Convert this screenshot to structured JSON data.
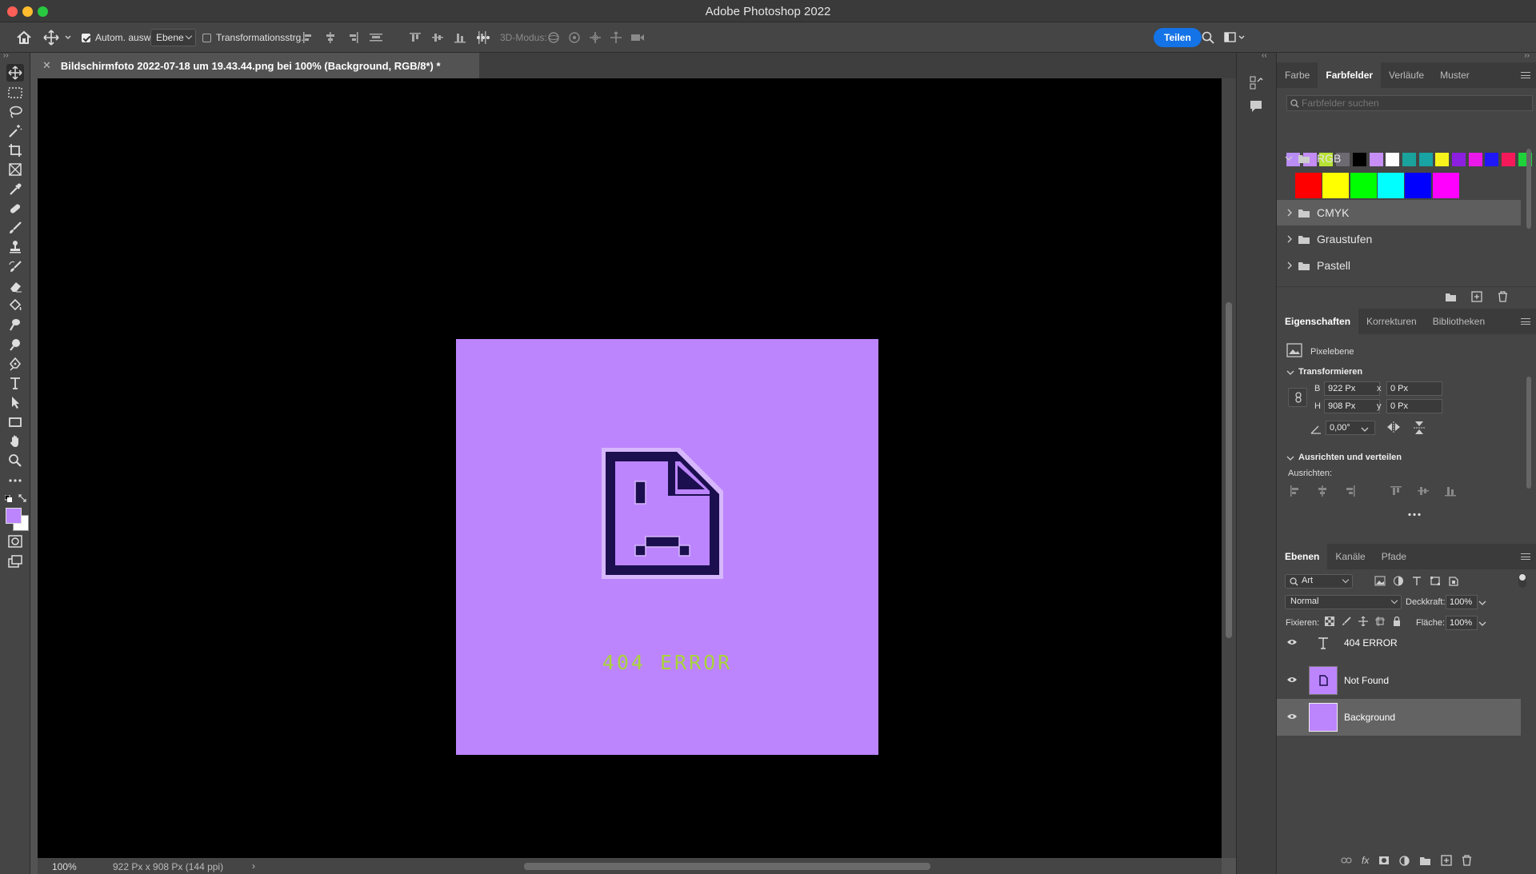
{
  "window": {
    "title": "Adobe Photoshop 2022"
  },
  "options_bar": {
    "auto_select_label": "Autom. ausw.:",
    "auto_select_checked": true,
    "auto_select_value": "Ebene",
    "transform_label": "Transformationsstrg.",
    "mode_3d_label": "3D-Modus:",
    "share_label": "Teilen"
  },
  "document": {
    "tab_title": "Bildschirmfoto 2022-07-18 um 19.43.44.png bei 100% (Background, RGB/8*) *",
    "canvas_text": "404 ERROR",
    "canvas_color": "#bc85fd",
    "text_color": "#a9d43a"
  },
  "status": {
    "zoom": "100%",
    "size": "922 Px x 908 Px (144 ppi)"
  },
  "swatches_panel": {
    "tabs": [
      "Farbe",
      "Farbfelder",
      "Verläufe",
      "Muster"
    ],
    "active_tab": "Farbfelder",
    "search_placeholder": "Farbfelder suchen",
    "recent_colors": [
      "#b98df5",
      "#c48cf7",
      "#b7e334",
      "#6d6a72",
      "#000000",
      "#c78ff5",
      "#ffffff",
      "#1aa39c",
      "#18a3a4",
      "#f7f21b",
      "#8c1fe0",
      "#ea18e8",
      "#1f17f5",
      "#f6195a",
      "#1ed33a"
    ],
    "groups": [
      {
        "name": "RGB",
        "expanded": true,
        "colors": [
          "#ff0000",
          "#ffff00",
          "#00ff00",
          "#00ffff",
          "#0000ff",
          "#ff00ff"
        ]
      },
      {
        "name": "CMYK",
        "expanded": false
      },
      {
        "name": "Graustufen",
        "expanded": false
      },
      {
        "name": "Pastell",
        "expanded": false
      }
    ]
  },
  "properties_panel": {
    "tabs": [
      "Eigenschaften",
      "Korrekturen",
      "Bibliotheken"
    ],
    "layer_type": "Pixelebene",
    "transform_header": "Transformieren",
    "w_label": "B",
    "w_value": "922 Px",
    "h_label": "H",
    "h_value": "908 Px",
    "x_label": "x",
    "x_value": "0 Px",
    "y_label": "y",
    "y_value": "0 Px",
    "angle_value": "0,00°",
    "align_header": "Ausrichten und verteilen",
    "align_label": "Ausrichten:"
  },
  "layers_panel": {
    "tabs": [
      "Ebenen",
      "Kanäle",
      "Pfade"
    ],
    "filter_value": "Art",
    "blend_mode": "Normal",
    "opacity_label": "Deckkraft:",
    "opacity_value": "100%",
    "lock_label": "Fixieren:",
    "fill_label": "Fläche:",
    "fill_value": "100%",
    "layers": [
      {
        "name": "404 ERROR",
        "kind": "text",
        "visible": true
      },
      {
        "name": "Not Found",
        "kind": "pixel",
        "visible": true
      },
      {
        "name": "Background",
        "kind": "pixel",
        "visible": true,
        "selected": true
      }
    ]
  },
  "icons": [
    "home-icon",
    "move-icon",
    "marquee-icon",
    "lasso-icon",
    "magic-wand-icon",
    "crop-icon",
    "frame-icon",
    "eyedropper-icon",
    "healing-icon",
    "brush-icon",
    "stamp-icon",
    "history-brush-icon",
    "eraser-icon",
    "paint-bucket-icon",
    "smudge-icon",
    "dodge-icon",
    "pen-icon",
    "type-icon",
    "path-select-icon",
    "rectangle-icon",
    "hand-icon",
    "zoom-icon",
    "search-icon",
    "folder-icon",
    "eye-icon"
  ]
}
